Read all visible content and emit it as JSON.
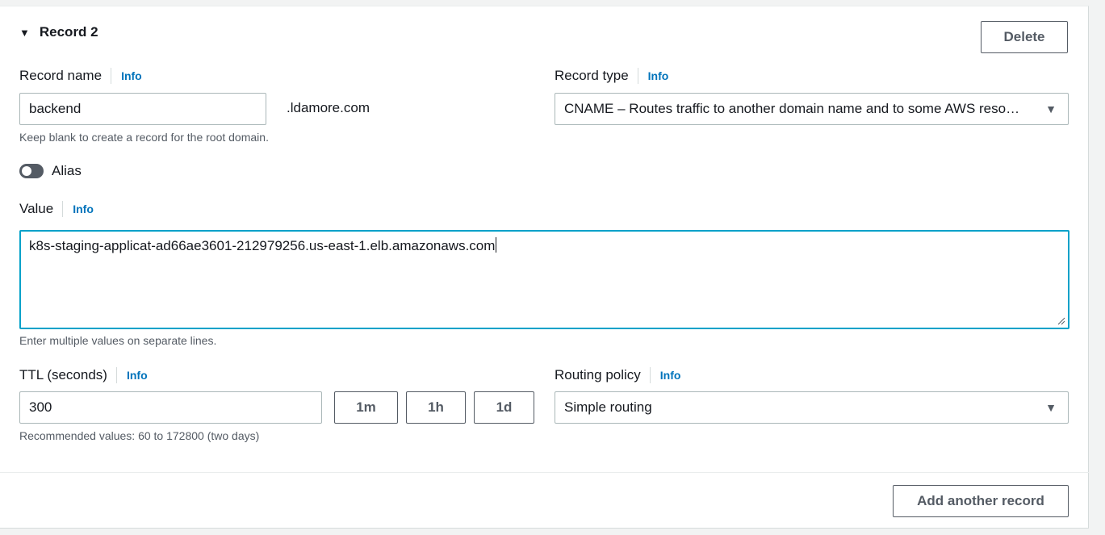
{
  "record": {
    "title": "Record 2",
    "delete_label": "Delete"
  },
  "record_name": {
    "label": "Record name",
    "info": "Info",
    "value": "backend",
    "suffix": ".ldamore.com",
    "hint": "Keep blank to create a record for the root domain."
  },
  "record_type": {
    "label": "Record type",
    "info": "Info",
    "selected": "CNAME – Routes traffic to another domain name and to some AWS reso…"
  },
  "alias": {
    "label": "Alias",
    "enabled": false
  },
  "value": {
    "label": "Value",
    "info": "Info",
    "text": "k8s-staging-applicat-ad66ae3601-212979256.us-east-1.elb.amazonaws.com",
    "hint": "Enter multiple values on separate lines."
  },
  "ttl": {
    "label": "TTL (seconds)",
    "info": "Info",
    "value": "300",
    "presets": [
      "1m",
      "1h",
      "1d"
    ],
    "hint": "Recommended values: 60 to 172800 (two days)"
  },
  "routing_policy": {
    "label": "Routing policy",
    "info": "Info",
    "selected": "Simple routing"
  },
  "footer": {
    "add_label": "Add another record"
  },
  "colors": {
    "link": "#0073bb",
    "focus_border": "#00a1c9",
    "button_text": "#545b64"
  },
  "icons": {
    "caret": "caret-down-icon",
    "select": "dropdown-arrow-icon"
  }
}
